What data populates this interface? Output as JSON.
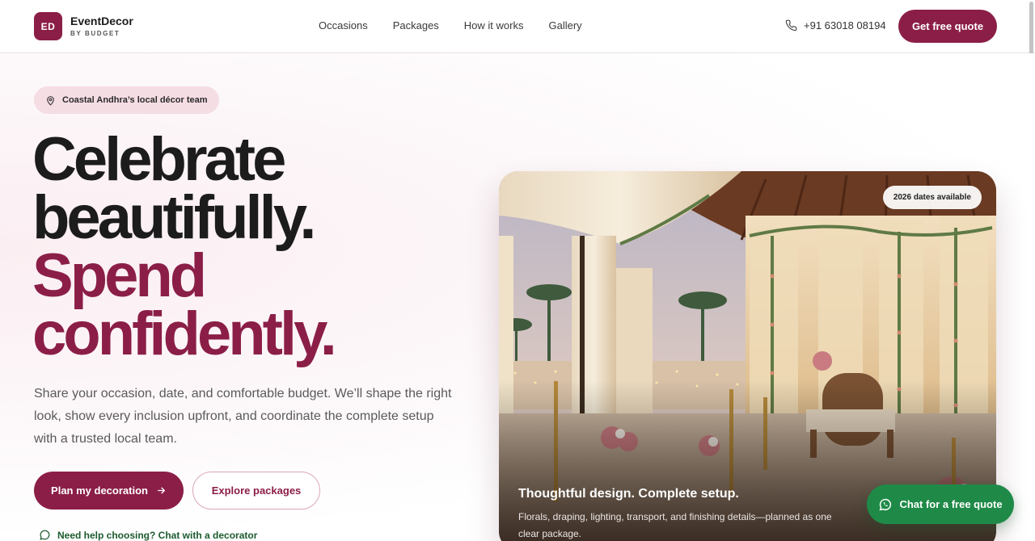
{
  "brand": {
    "badge": "ED",
    "name": "EventDecor",
    "sub": "BY BUDGET"
  },
  "nav": [
    "Occasions",
    "Packages",
    "How it works",
    "Gallery"
  ],
  "header": {
    "phone": "+91 63018 08194",
    "cta": "Get free quote"
  },
  "hero": {
    "pill": "Coastal Andhra’s local décor team",
    "headline": [
      "Celebrate",
      "beautifully.",
      "Spend",
      "confidently."
    ],
    "lede": "Share your occasion, date, and comfortable budget. We’ll shape the right look, show every inclusion upfront, and coordinate the complete setup with a trusted local team.",
    "primary_cta": "Plan my decoration",
    "secondary_cta": "Explore packages",
    "help": "Need help choosing? Chat with a decorator"
  },
  "card": {
    "badge": "2026 dates available",
    "title": "Thoughtful design. Complete setup.",
    "description": "Florals, draping, lighting, transport, and finishing details—planned as one clear package."
  },
  "chat": {
    "label": "Chat for a free quote"
  },
  "colors": {
    "brand": "#8b1e47",
    "whatsapp": "#1f8a48"
  }
}
